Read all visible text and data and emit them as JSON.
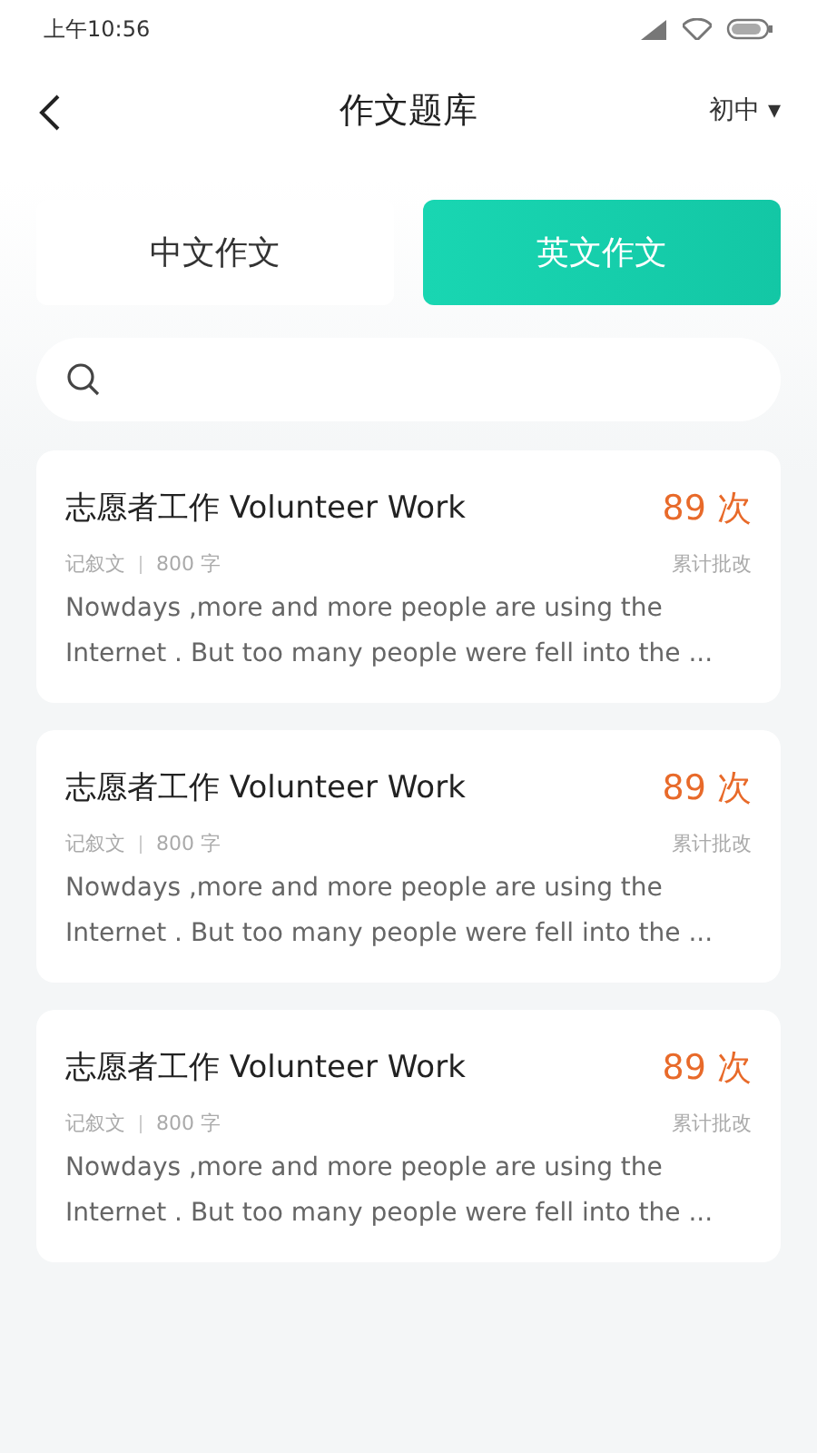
{
  "status_bar": {
    "time": "上午10:56"
  },
  "header": {
    "title": "作文题库",
    "grade": "初中",
    "caret": "▾"
  },
  "tabs": [
    {
      "label": "中文作文",
      "selected": false
    },
    {
      "label": "英文作文",
      "selected": true
    }
  ],
  "essays": [
    {
      "title": "志愿者工作 Volunteer Work",
      "count": "89 次",
      "genre": "记叙文",
      "words": "800 字",
      "count_label": "累计批改",
      "excerpt": "Nowdays ,more and more people are using the Internet . But too many people were fell into the ..."
    },
    {
      "title": "志愿者工作 Volunteer Work",
      "count": "89 次",
      "genre": "记叙文",
      "words": "800 字",
      "count_label": "累计批改",
      "excerpt": "Nowdays ,more and more people are using the Internet . But too many people were fell into the ..."
    },
    {
      "title": "志愿者工作 Volunteer Work",
      "count": "89 次",
      "genre": "记叙文",
      "words": "800 字",
      "count_label": "累计批改",
      "excerpt": "Nowdays ,more and more people are using the Internet . But too many people were fell into the ..."
    }
  ]
}
